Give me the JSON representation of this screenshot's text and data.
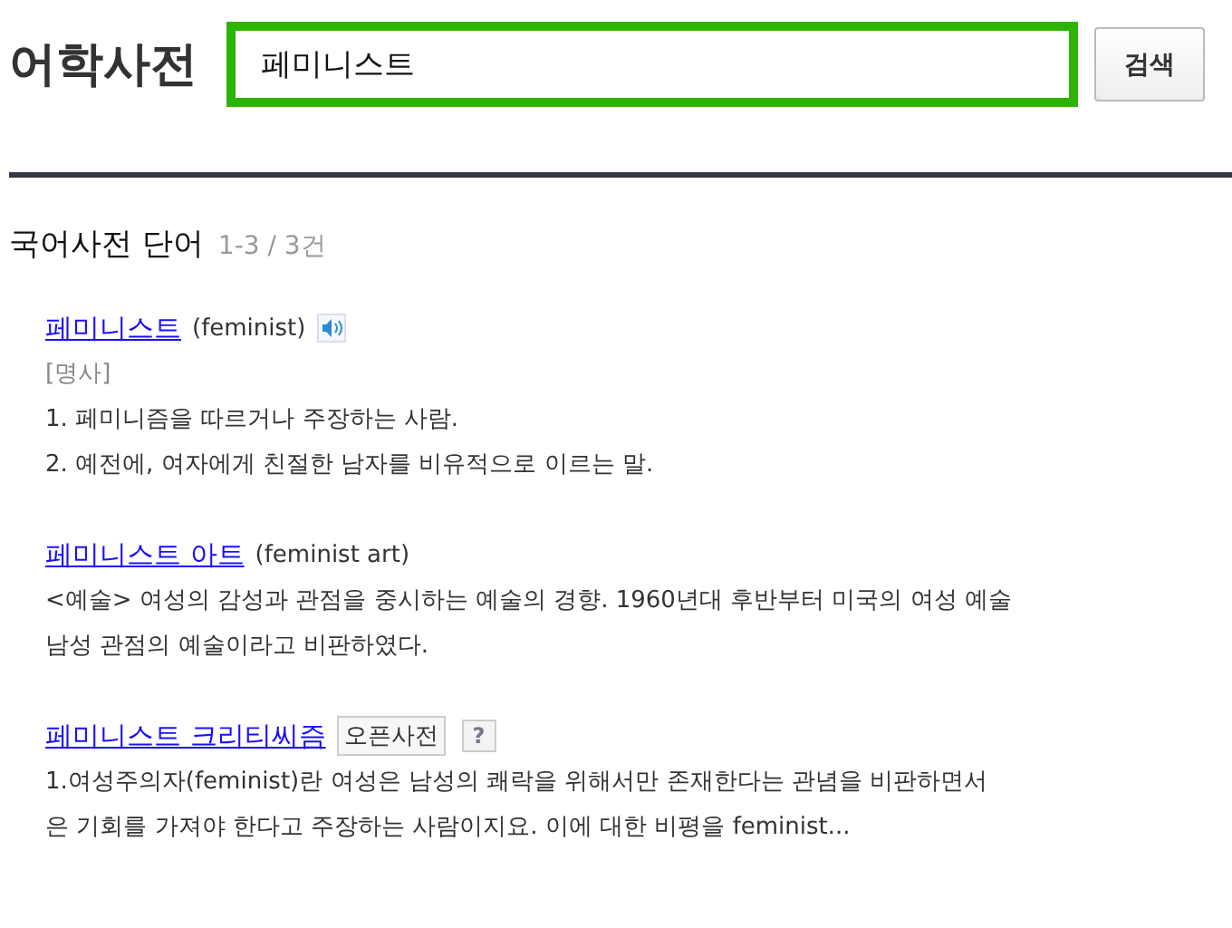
{
  "header": {
    "title": "어학사전",
    "search": {
      "value": "페미니스트"
    },
    "button": "검색"
  },
  "section": {
    "title": "국어사전 단어",
    "count": "1-3 / 3건"
  },
  "entries": [
    {
      "word": "페미니스트",
      "original": "(feminist)",
      "audio": true,
      "pos": "[명사]",
      "lines": [
        "1. 페미니즘을 따르거나 주장하는 사람.",
        "2. 예전에, 여자에게 친절한 남자를 비유적으로 이르는 말."
      ]
    },
    {
      "word": "페미니스트 아트",
      "original": "(feminist art)",
      "audio": false,
      "lines": [
        "<예술> 여성의 감성과 관점을 중시하는 예술의 경향. 1960년대 후반부터 미국의 여성 예술",
        "남성 관점의 예술이라고 비판하였다."
      ]
    },
    {
      "word": "페미니스트 크리티씨즘",
      "audio": false,
      "badges": [
        {
          "kind": "source",
          "label": "오픈사전"
        },
        {
          "kind": "help",
          "label": "?"
        }
      ],
      "lines": [
        "1.여성주의자(feminist)란 여성은 남성의 쾌락을 위해서만 존재한다는 관념을 비판하면서",
        "은 기회를 가져야 한다고 주장하는 사람이지요. 이에 대한 비평을 feminist..."
      ]
    }
  ]
}
